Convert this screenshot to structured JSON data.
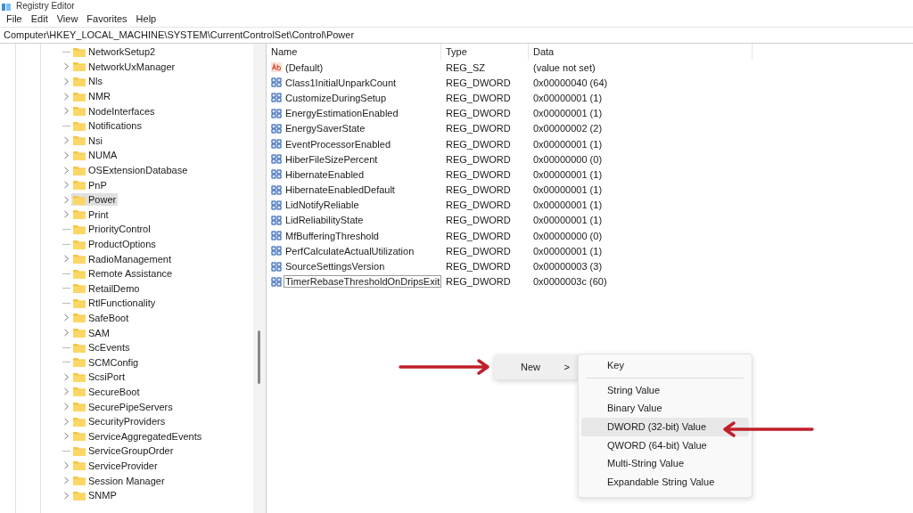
{
  "window": {
    "title": "Registry Editor"
  },
  "menu": [
    "File",
    "Edit",
    "View",
    "Favorites",
    "Help"
  ],
  "address": "Computer\\HKEY_LOCAL_MACHINE\\SYSTEM\\CurrentControlSet\\Control\\Power",
  "tree": [
    {
      "label": "NetworkSetup2",
      "expandable": false,
      "selected": false
    },
    {
      "label": "NetworkUxManager",
      "expandable": true,
      "selected": false
    },
    {
      "label": "Nls",
      "expandable": true,
      "selected": false
    },
    {
      "label": "NMR",
      "expandable": true,
      "selected": false
    },
    {
      "label": "NodeInterfaces",
      "expandable": true,
      "selected": false
    },
    {
      "label": "Notifications",
      "expandable": false,
      "selected": false
    },
    {
      "label": "Nsi",
      "expandable": true,
      "selected": false
    },
    {
      "label": "NUMA",
      "expandable": true,
      "selected": false
    },
    {
      "label": "OSExtensionDatabase",
      "expandable": true,
      "selected": false
    },
    {
      "label": "PnP",
      "expandable": true,
      "selected": false
    },
    {
      "label": "Power",
      "expandable": true,
      "selected": true
    },
    {
      "label": "Print",
      "expandable": true,
      "selected": false
    },
    {
      "label": "PriorityControl",
      "expandable": false,
      "selected": false
    },
    {
      "label": "ProductOptions",
      "expandable": false,
      "selected": false
    },
    {
      "label": "RadioManagement",
      "expandable": true,
      "selected": false
    },
    {
      "label": "Remote Assistance",
      "expandable": false,
      "selected": false
    },
    {
      "label": "RetailDemo",
      "expandable": false,
      "selected": false
    },
    {
      "label": "RtlFunctionality",
      "expandable": false,
      "selected": false
    },
    {
      "label": "SafeBoot",
      "expandable": true,
      "selected": false
    },
    {
      "label": "SAM",
      "expandable": true,
      "selected": false
    },
    {
      "label": "ScEvents",
      "expandable": false,
      "selected": false
    },
    {
      "label": "SCMConfig",
      "expandable": false,
      "selected": false
    },
    {
      "label": "ScsiPort",
      "expandable": true,
      "selected": false
    },
    {
      "label": "SecureBoot",
      "expandable": true,
      "selected": false
    },
    {
      "label": "SecurePipeServers",
      "expandable": true,
      "selected": false
    },
    {
      "label": "SecurityProviders",
      "expandable": true,
      "selected": false
    },
    {
      "label": "ServiceAggregatedEvents",
      "expandable": true,
      "selected": false
    },
    {
      "label": "ServiceGroupOrder",
      "expandable": false,
      "selected": false
    },
    {
      "label": "ServiceProvider",
      "expandable": true,
      "selected": false
    },
    {
      "label": "Session Manager",
      "expandable": true,
      "selected": false
    },
    {
      "label": "SNMP",
      "expandable": true,
      "selected": false
    }
  ],
  "columns": [
    "Name",
    "Type",
    "Data"
  ],
  "values": [
    {
      "kind": "string",
      "name": "(Default)",
      "type": "REG_SZ",
      "data": "(value not set)",
      "focused": false
    },
    {
      "kind": "binary",
      "name": "Class1InitialUnparkCount",
      "type": "REG_DWORD",
      "data": "0x00000040 (64)",
      "focused": false
    },
    {
      "kind": "binary",
      "name": "CustomizeDuringSetup",
      "type": "REG_DWORD",
      "data": "0x00000001 (1)",
      "focused": false
    },
    {
      "kind": "binary",
      "name": "EnergyEstimationEnabled",
      "type": "REG_DWORD",
      "data": "0x00000001 (1)",
      "focused": false
    },
    {
      "kind": "binary",
      "name": "EnergySaverState",
      "type": "REG_DWORD",
      "data": "0x00000002 (2)",
      "focused": false
    },
    {
      "kind": "binary",
      "name": "EventProcessorEnabled",
      "type": "REG_DWORD",
      "data": "0x00000001 (1)",
      "focused": false
    },
    {
      "kind": "binary",
      "name": "HiberFileSizePercent",
      "type": "REG_DWORD",
      "data": "0x00000000 (0)",
      "focused": false
    },
    {
      "kind": "binary",
      "name": "HibernateEnabled",
      "type": "REG_DWORD",
      "data": "0x00000001 (1)",
      "focused": false
    },
    {
      "kind": "binary",
      "name": "HibernateEnabledDefault",
      "type": "REG_DWORD",
      "data": "0x00000001 (1)",
      "focused": false
    },
    {
      "kind": "binary",
      "name": "LidNotifyReliable",
      "type": "REG_DWORD",
      "data": "0x00000001 (1)",
      "focused": false
    },
    {
      "kind": "binary",
      "name": "LidReliabilityState",
      "type": "REG_DWORD",
      "data": "0x00000001 (1)",
      "focused": false
    },
    {
      "kind": "binary",
      "name": "MfBufferingThreshold",
      "type": "REG_DWORD",
      "data": "0x00000000 (0)",
      "focused": false
    },
    {
      "kind": "binary",
      "name": "PerfCalculateActualUtilization",
      "type": "REG_DWORD",
      "data": "0x00000001 (1)",
      "focused": false
    },
    {
      "kind": "binary",
      "name": "SourceSettingsVersion",
      "type": "REG_DWORD",
      "data": "0x00000003 (3)",
      "focused": false
    },
    {
      "kind": "binary",
      "name": "TimerRebaseThresholdOnDripsExit",
      "type": "REG_DWORD",
      "data": "0x0000003c (60)",
      "focused": true
    }
  ],
  "context_menu": {
    "item": {
      "label": "New",
      "chevron": ">"
    },
    "submenu": [
      {
        "label": "Key",
        "selected": false,
        "separator_after": true
      },
      {
        "label": "String Value",
        "selected": false,
        "separator_after": false
      },
      {
        "label": "Binary Value",
        "selected": false,
        "separator_after": false
      },
      {
        "label": "DWORD (32-bit) Value",
        "selected": true,
        "separator_after": false
      },
      {
        "label": "QWORD (64-bit) Value",
        "selected": false,
        "separator_after": false
      },
      {
        "label": "Multi-String Value",
        "selected": false,
        "separator_after": false
      },
      {
        "label": "Expandable String Value",
        "selected": false,
        "separator_after": false
      }
    ]
  }
}
